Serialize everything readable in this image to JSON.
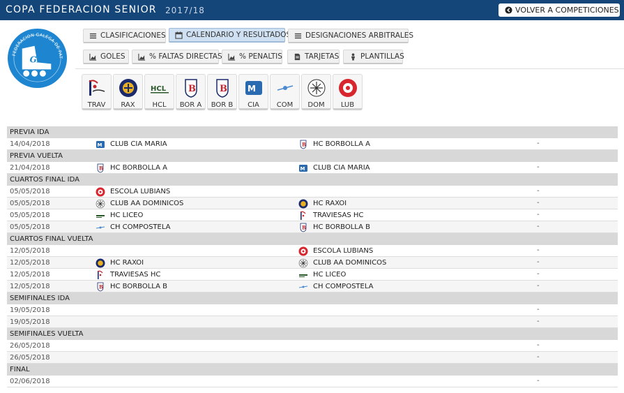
{
  "header": {
    "title": "COPA FEDERACION SENIOR",
    "season": "2017/18",
    "back_button": "VOLVER A COMPETICIONES"
  },
  "logo": {
    "text": "FEDERACION GALEGA DE PATINAXE",
    "initials": "FGP"
  },
  "colors": {
    "header_bg": "#14467a",
    "active_tab": "#cfe0f2",
    "round_bg": "#d8d8d8"
  },
  "tabs_row1": [
    {
      "label": "CLASIFICACIONES",
      "icon": "list-icon",
      "active": false
    },
    {
      "label": "CALENDARIO Y RESULTADOS",
      "icon": "calendar-icon",
      "active": true
    },
    {
      "label": "DESIGNACIONES ARBITRALES",
      "icon": "list-icon",
      "active": false
    }
  ],
  "tabs_row2": [
    {
      "label": "GOLES",
      "icon": "chart-icon"
    },
    {
      "label": "% FALTAS DIRECTAS",
      "icon": "chart-icon"
    },
    {
      "label": "% PENALTIS",
      "icon": "chart-icon"
    },
    {
      "label": "TARJETAS",
      "icon": "card-icon"
    },
    {
      "label": "PLANTILLAS",
      "icon": "person-icon"
    }
  ],
  "teams": [
    {
      "abbr": "TRAV",
      "name": "TRAVIESAS HC"
    },
    {
      "abbr": "RAX",
      "name": "HC RAXOI"
    },
    {
      "abbr": "HCL",
      "name": "HC LICEO"
    },
    {
      "abbr": "BOR A",
      "name": "HC BORBOLLA A"
    },
    {
      "abbr": "BOR B",
      "name": "HC BORBOLLA B"
    },
    {
      "abbr": "CIA",
      "name": "CLUB CIA MARIA"
    },
    {
      "abbr": "COM",
      "name": "CH COMPOSTELA"
    },
    {
      "abbr": "DOM",
      "name": "CLUB AA DOMINICOS"
    },
    {
      "abbr": "LUB",
      "name": "ESCOLA LUBIANS"
    }
  ],
  "rounds": [
    {
      "name": "PREVIA IDA",
      "matches": [
        {
          "date": "14/04/2018",
          "home": "CLUB CIA MARIA",
          "home_icon": "cia",
          "away": "HC BORBOLLA A",
          "away_icon": "bora",
          "result": "-"
        }
      ]
    },
    {
      "name": "PREVIA VUELTA",
      "matches": [
        {
          "date": "21/04/2018",
          "home": "HC BORBOLLA A",
          "home_icon": "bora",
          "away": "CLUB CIA MARIA",
          "away_icon": "cia",
          "result": "-"
        }
      ]
    },
    {
      "name": "CUARTOS FINAL IDA",
      "matches": [
        {
          "date": "05/05/2018",
          "home": "ESCOLA LUBIANS",
          "home_icon": "lub",
          "away": "",
          "away_icon": "",
          "result": "-"
        },
        {
          "date": "05/05/2018",
          "home": "CLUB AA DOMINICOS",
          "home_icon": "dom",
          "away": "HC RAXOI",
          "away_icon": "rax",
          "result": "-"
        },
        {
          "date": "05/05/2018",
          "home": "HC LICEO",
          "home_icon": "hcl",
          "away": "TRAVIESAS HC",
          "away_icon": "trav",
          "result": "-"
        },
        {
          "date": "05/05/2018",
          "home": "CH COMPOSTELA",
          "home_icon": "com",
          "away": "HC BORBOLLA B",
          "away_icon": "borb",
          "result": "-"
        }
      ]
    },
    {
      "name": "CUARTOS FINAL VUELTA",
      "matches": [
        {
          "date": "12/05/2018",
          "home": "",
          "home_icon": "",
          "away": "ESCOLA LUBIANS",
          "away_icon": "lub",
          "result": "-"
        },
        {
          "date": "12/05/2018",
          "home": "HC RAXOI",
          "home_icon": "rax",
          "away": "CLUB AA DOMINICOS",
          "away_icon": "dom",
          "result": "-"
        },
        {
          "date": "12/05/2018",
          "home": "TRAVIESAS HC",
          "home_icon": "trav",
          "away": "HC LICEO",
          "away_icon": "hcl",
          "result": "-"
        },
        {
          "date": "12/05/2018",
          "home": "HC BORBOLLA B",
          "home_icon": "borb",
          "away": "CH COMPOSTELA",
          "away_icon": "com",
          "result": "-"
        }
      ]
    },
    {
      "name": "SEMIFINALES IDA",
      "matches": [
        {
          "date": "19/05/2018",
          "home": "",
          "home_icon": "",
          "away": "",
          "away_icon": "",
          "result": "-"
        },
        {
          "date": "19/05/2018",
          "home": "",
          "home_icon": "",
          "away": "",
          "away_icon": "",
          "result": "-"
        }
      ]
    },
    {
      "name": "SEMIFINALES VUELTA",
      "matches": [
        {
          "date": "26/05/2018",
          "home": "",
          "home_icon": "",
          "away": "",
          "away_icon": "",
          "result": "-"
        },
        {
          "date": "26/05/2018",
          "home": "",
          "home_icon": "",
          "away": "",
          "away_icon": "",
          "result": "-"
        }
      ]
    },
    {
      "name": "FINAL",
      "matches": [
        {
          "date": "02/06/2018",
          "home": "",
          "home_icon": "",
          "away": "",
          "away_icon": "",
          "result": "-"
        }
      ]
    }
  ]
}
